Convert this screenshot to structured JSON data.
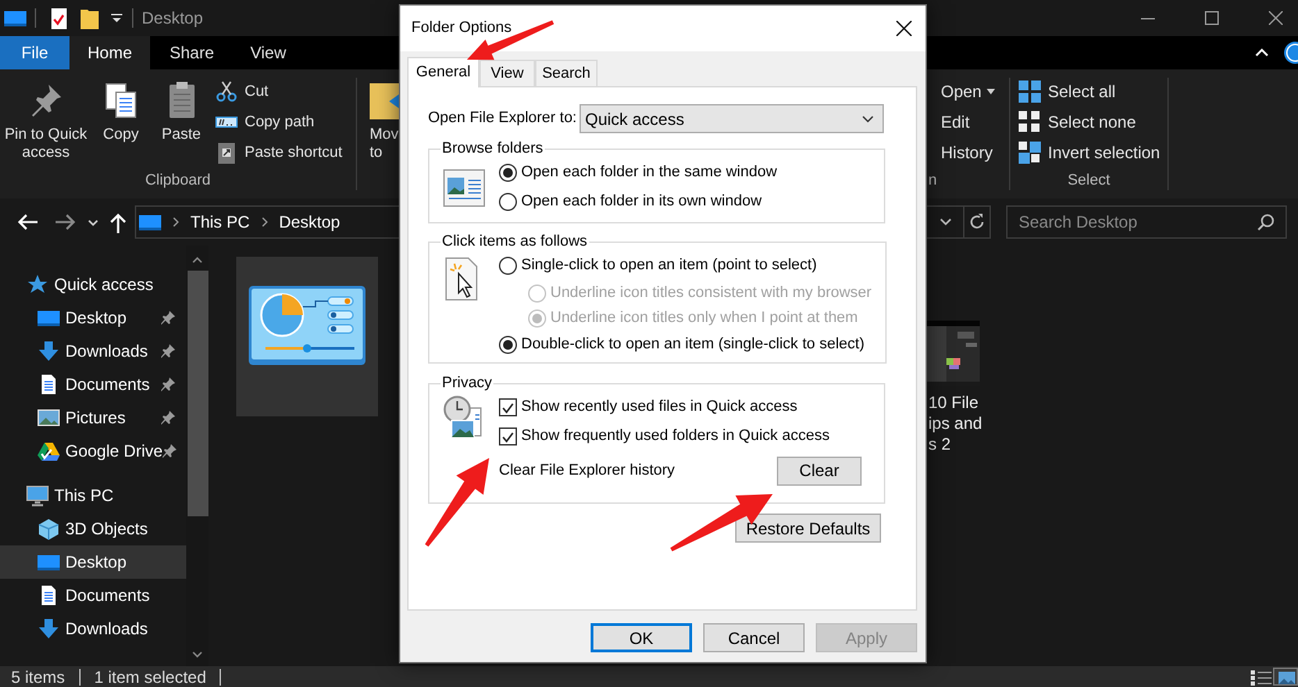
{
  "explorer": {
    "title": "Desktop",
    "ribbon_tabs": [
      {
        "label": "File",
        "kind": "menu",
        "selected": false
      },
      {
        "label": "Home",
        "kind": "tab",
        "selected": true
      },
      {
        "label": "Share",
        "kind": "tab",
        "selected": false
      },
      {
        "label": "View",
        "kind": "tab",
        "selected": false
      }
    ],
    "clipboard": {
      "large_buttons": [
        "Pin to Quick access",
        "Copy",
        "Paste"
      ],
      "small_buttons": [
        "Cut",
        "Copy path",
        "Paste shortcut"
      ],
      "label": "Clipboard"
    },
    "move_to": {
      "label_lines": [
        "Mov",
        "to"
      ]
    },
    "open_group": {
      "buttons": [
        "Open",
        "Edit",
        "History"
      ],
      "label": "n"
    },
    "select_group": {
      "buttons": [
        "Select all",
        "Select none",
        "Invert selection"
      ],
      "label": "Select"
    },
    "address": {
      "path": [
        "This PC",
        "Desktop"
      ]
    },
    "search": {
      "placeholder": "Search Desktop"
    },
    "nav": [
      {
        "label": "Quick access",
        "selected": false,
        "children": [
          {
            "label": "Desktop",
            "pinned": true,
            "selected": false
          },
          {
            "label": "Downloads",
            "pinned": true,
            "selected": false
          },
          {
            "label": "Documents",
            "pinned": true,
            "selected": false
          },
          {
            "label": "Pictures",
            "pinned": true,
            "selected": false
          },
          {
            "label": "Google Drive",
            "pinned": true,
            "selected": false
          }
        ]
      },
      {
        "label": "This PC",
        "selected": false,
        "children": [
          {
            "label": "3D Objects",
            "pinned": false,
            "selected": false
          },
          {
            "label": "Desktop",
            "pinned": false,
            "selected": true
          },
          {
            "label": "Documents",
            "pinned": false,
            "selected": false
          },
          {
            "label": "Downloads",
            "pinned": false,
            "selected": false
          }
        ]
      }
    ],
    "files": [
      {
        "selected": true
      },
      {
        "label_lines": [
          "10 File",
          "ips and",
          "s 2"
        ],
        "selected": false
      }
    ],
    "status": {
      "texts": [
        "5 items",
        "1 item selected"
      ],
      "views": [
        {
          "selected": false
        },
        {
          "selected": true
        }
      ]
    }
  },
  "dialog": {
    "title": "Folder Options",
    "tabs": [
      {
        "label": "General",
        "selected": true
      },
      {
        "label": "View",
        "selected": false
      },
      {
        "label": "Search",
        "selected": false
      }
    ],
    "open_to": {
      "label": "Open File Explorer to:",
      "value": "Quick access"
    },
    "groups": [
      {
        "title": "Browse folders",
        "options": [
          {
            "kind": "radio",
            "label": "Open each folder in the same window",
            "checked": true,
            "disabled": false
          },
          {
            "kind": "radio",
            "label": "Open each folder in its own window",
            "checked": false,
            "disabled": false
          }
        ]
      },
      {
        "title": "Click items as follows",
        "options": [
          {
            "kind": "radio",
            "label": "Single-click to open an item (point to select)",
            "checked": false,
            "disabled": false,
            "children": [
              {
                "kind": "radio",
                "label": "Underline icon titles consistent with my browser",
                "checked": false,
                "disabled": true
              },
              {
                "kind": "radio",
                "label": "Underline icon titles only when I point at them",
                "checked": true,
                "disabled": true
              }
            ]
          },
          {
            "kind": "radio",
            "label": "Double-click to open an item (single-click to select)",
            "checked": true,
            "disabled": false
          }
        ]
      },
      {
        "title": "Privacy",
        "options": [
          {
            "kind": "checkbox",
            "label": "Show recently used files in Quick access",
            "checked": true,
            "disabled": false
          },
          {
            "kind": "checkbox",
            "label": "Show frequently used folders in Quick access",
            "checked": true,
            "disabled": false
          },
          {
            "kind": "action",
            "label": "Clear File Explorer history",
            "button": "Clear"
          }
        ]
      }
    ],
    "restore_button": "Restore Defaults",
    "buttons": [
      {
        "label": "OK",
        "default": true,
        "disabled": false
      },
      {
        "label": "Cancel",
        "default": false,
        "disabled": false
      },
      {
        "label": "Apply",
        "default": false,
        "disabled": true
      }
    ]
  }
}
